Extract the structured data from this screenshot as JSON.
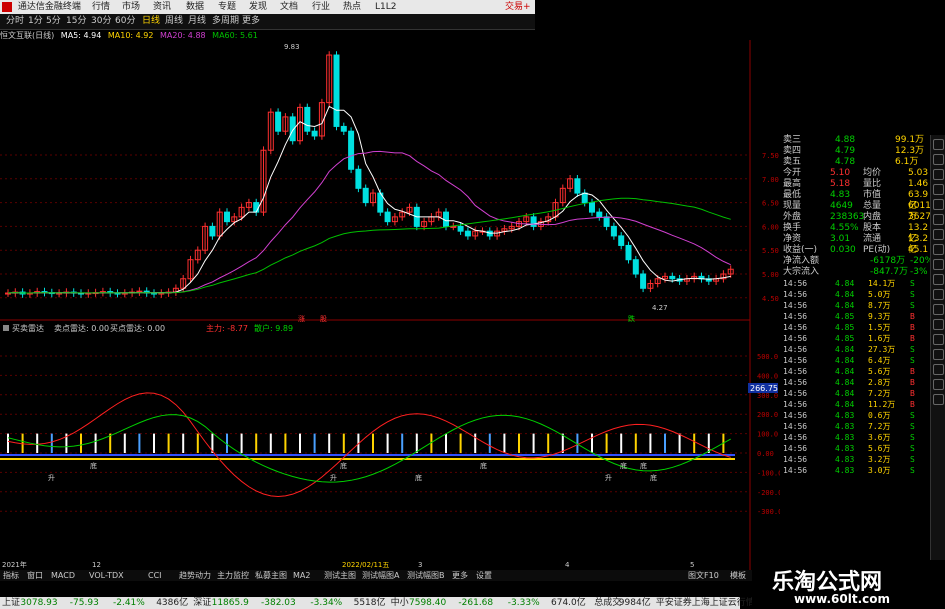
{
  "titlebar": {
    "app": "通达信金融终端",
    "menus": [
      "行情",
      "市场",
      "资讯",
      "数据",
      "专题",
      "发现",
      "文档",
      "行业",
      "热点",
      "L1L2"
    ],
    "trade": "交易+"
  },
  "period": {
    "items": [
      "分时",
      "1分",
      "5分",
      "15分",
      "30分",
      "60分",
      "日线",
      "周线",
      "月线",
      "多周期",
      "更多"
    ],
    "active": "日线"
  },
  "stock_name": "恒文互联(日线)",
  "ma": [
    {
      "label": "MA5: 4.94",
      "color": "#ffffff"
    },
    {
      "label": "MA10: 4.92",
      "color": "#ffd400"
    },
    {
      "label": "MA20: 4.88",
      "color": "#d040d0"
    },
    {
      "label": "MA60: 5.61",
      "color": "#00c000"
    }
  ],
  "price_axis": [
    "7.50",
    "7.00",
    "6.50",
    "6.00",
    "5.50",
    "5.00",
    "4.50"
  ],
  "high_mark": "9.83",
  "low_mark": "4.27",
  "ind_title": "买卖雷达",
  "ind_vals": [
    "卖点雷达: 0.00",
    "买点雷达: 0.00"
  ],
  "ind2": {
    "a": "主力: -8.77",
    "b": "散户: 9.89"
  },
  "ind_axis": [
    "500.0",
    "400.0",
    "300.0",
    "200.0",
    "100.0",
    "0.00",
    "-100.0",
    "-200.0",
    "-300.0"
  ],
  "ind_marker": "266.75",
  "date_labels": [
    "2021年",
    "12",
    "2022/02/11五",
    "3",
    "4",
    "5"
  ],
  "quote": {
    "rows": [
      [
        "卖三",
        "4.88",
        "99.1万"
      ],
      [
        "卖四",
        "4.79",
        "12.3万"
      ],
      [
        "卖五",
        "4.78",
        "6.1万"
      ]
    ],
    "stats": [
      [
        "今开",
        "5.10",
        "均价",
        "5.03"
      ],
      [
        "最高",
        "5.18",
        "量比",
        "1.46"
      ],
      [
        "最低",
        "4.83",
        "市值",
        "63.9亿"
      ],
      [
        "现量",
        "4649",
        "总量",
        "60114万"
      ],
      [
        "外盘",
        "238363",
        "内盘",
        "362784"
      ],
      [
        "换手",
        "4.55%",
        "股本",
        "13.2亿"
      ],
      [
        "净资",
        "3.01",
        "流通",
        "13.2亿"
      ],
      [
        "收益(一)",
        "0.030",
        "PE(动)",
        "45.1"
      ]
    ],
    "flow": [
      [
        "净流入额",
        "-6178万",
        "-20%"
      ],
      [
        "大宗流入",
        "-847.7万",
        "-3%"
      ]
    ]
  },
  "ticks": [
    [
      "14:56",
      "4.84",
      "14.1万",
      "S"
    ],
    [
      "14:56",
      "4.84",
      "5.0万",
      "S"
    ],
    [
      "14:56",
      "4.84",
      "8.7万",
      "S"
    ],
    [
      "14:56",
      "4.85",
      "9.3万",
      "B"
    ],
    [
      "14:56",
      "4.85",
      "1.5万",
      "B"
    ],
    [
      "14:56",
      "4.85",
      "1.6万",
      "B"
    ],
    [
      "14:56",
      "4.84",
      "27.3万",
      "S"
    ],
    [
      "14:56",
      "4.84",
      "6.4万",
      "S"
    ],
    [
      "14:56",
      "4.84",
      "5.6万",
      "B"
    ],
    [
      "14:56",
      "4.84",
      "2.8万",
      "B"
    ],
    [
      "14:56",
      "4.84",
      "7.2万",
      "B"
    ],
    [
      "14:56",
      "4.84",
      "11.2万",
      "B"
    ],
    [
      "14:56",
      "4.83",
      "0.6万",
      "S"
    ],
    [
      "14:56",
      "4.83",
      "7.2万",
      "S"
    ],
    [
      "14:56",
      "4.83",
      "3.6万",
      "S"
    ],
    [
      "14:56",
      "4.83",
      "5.6万",
      "S"
    ],
    [
      "14:56",
      "4.83",
      "3.2万",
      "S"
    ],
    [
      "14:56",
      "4.83",
      "3.0万",
      "S"
    ]
  ],
  "bottom_tabs": [
    "指标",
    "窗口",
    "MACD",
    "VOL-TDX",
    "CCI",
    "趋势动力",
    "主力监控",
    "私募主图",
    "MA2",
    "测试主图",
    "测试幅图A",
    "测试幅图B",
    "更多",
    "设置"
  ],
  "status": [
    {
      "t": "上证",
      "c": "#222"
    },
    {
      "t": "3078.93",
      "c": "#008000"
    },
    {
      "t": "-75.93",
      "c": "#008000"
    },
    {
      "t": "-2.41%",
      "c": "#008000"
    },
    {
      "t": "4386亿",
      "c": "#222"
    },
    {
      "t": "深证",
      "c": "#222"
    },
    {
      "t": "11865.9",
      "c": "#008000"
    },
    {
      "t": "-382.03",
      "c": "#008000"
    },
    {
      "t": "-3.34%",
      "c": "#008000"
    },
    {
      "t": "5518亿",
      "c": "#222"
    },
    {
      "t": "中小",
      "c": "#222"
    },
    {
      "t": "7598.40",
      "c": "#008000"
    },
    {
      "t": "-261.68",
      "c": "#008000"
    },
    {
      "t": "-3.33%",
      "c": "#008000"
    },
    {
      "t": "674.0亿",
      "c": "#222"
    },
    {
      "t": "总成交",
      "c": "#222"
    },
    {
      "t": "9984亿",
      "c": "#222"
    },
    {
      "t": "平安证券上海上证云行情",
      "c": "#222"
    }
  ],
  "watermark": {
    "cn": "乐淘公式网",
    "url": "www.60lt.com"
  },
  "tabs_right": [
    "图文F10",
    "模板"
  ],
  "signals": [
    "涨",
    "股",
    "跌",
    "升",
    "底",
    "升",
    "底",
    "底",
    "底",
    "升",
    "底",
    "底",
    "底"
  ]
}
